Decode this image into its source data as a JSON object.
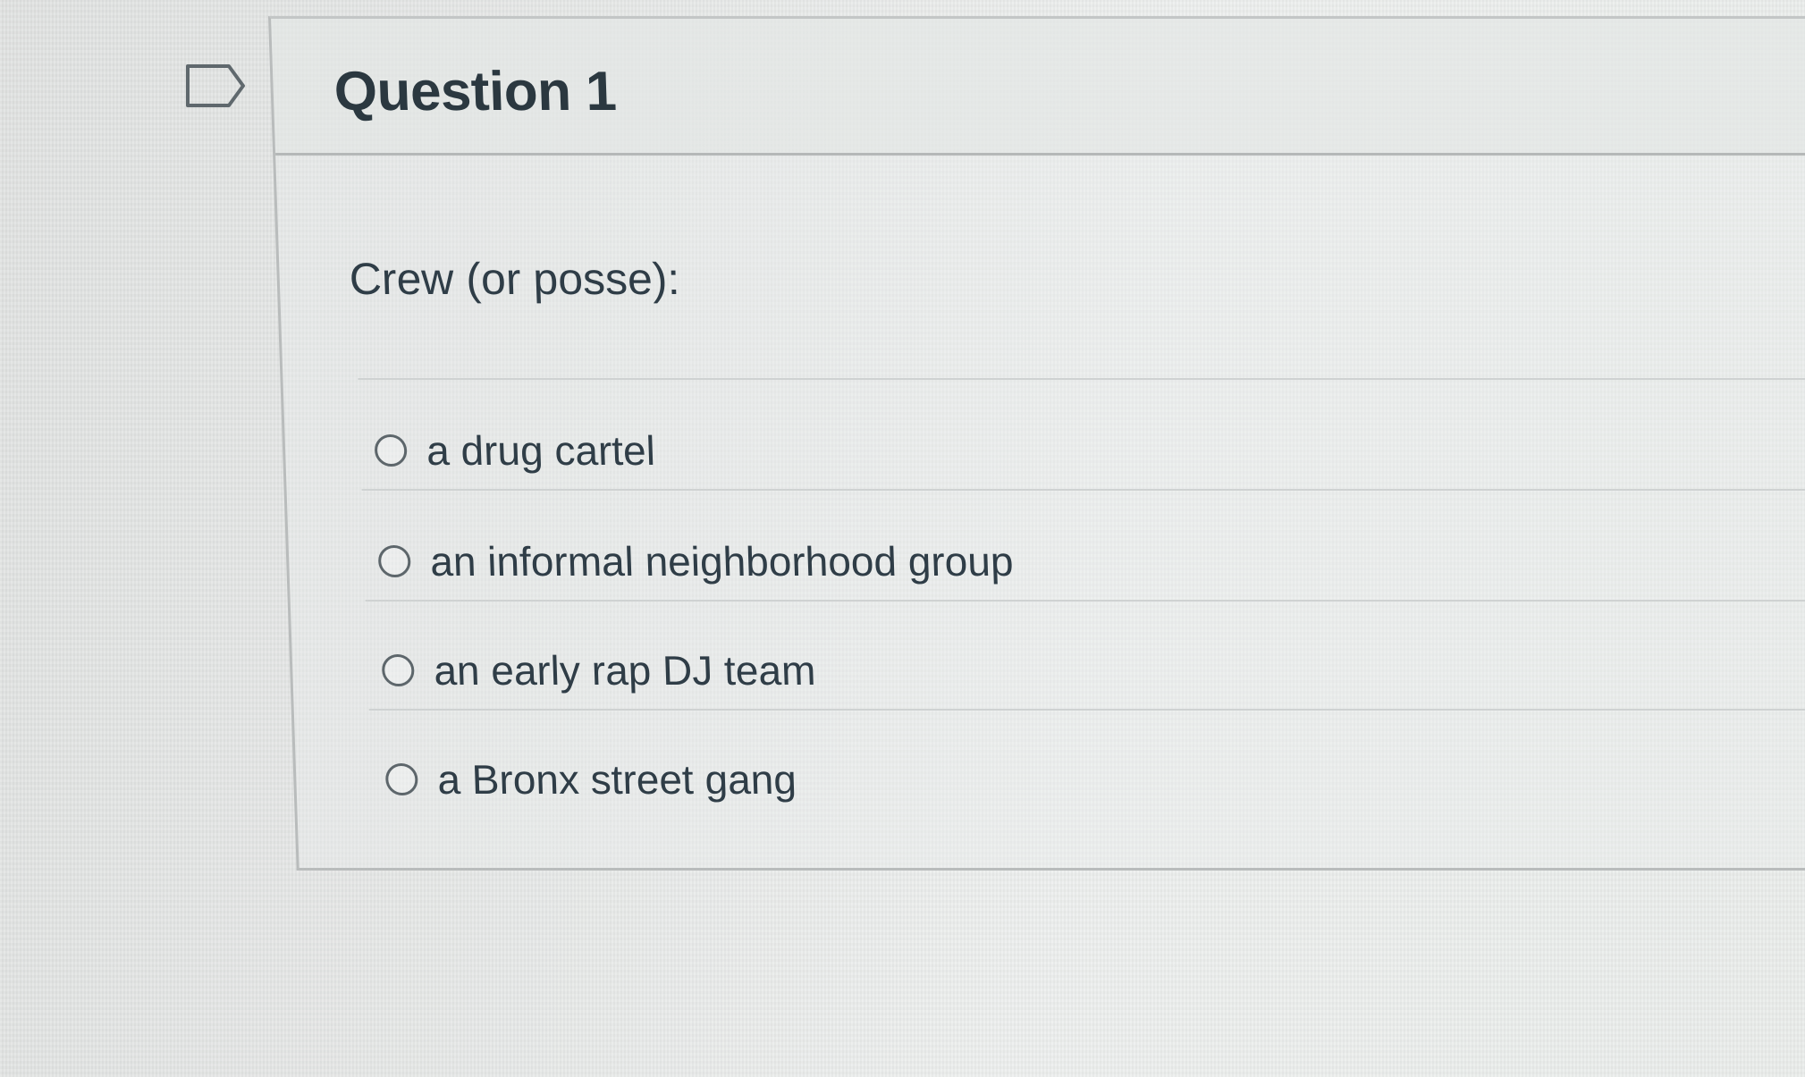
{
  "question": {
    "title": "Question 1",
    "prompt": "Crew (or posse):",
    "answers": [
      {
        "label": "a drug cartel",
        "selected": false
      },
      {
        "label": "an informal neighborhood group",
        "selected": false
      },
      {
        "label": "an early rap DJ team",
        "selected": false
      },
      {
        "label": "a Bronx street gang",
        "selected": false
      }
    ]
  },
  "colors": {
    "text": "#2d3b45",
    "border": "#b9bcbc",
    "radio_border": "#5d666b"
  },
  "icons": {
    "flag": "flag-question-icon"
  }
}
